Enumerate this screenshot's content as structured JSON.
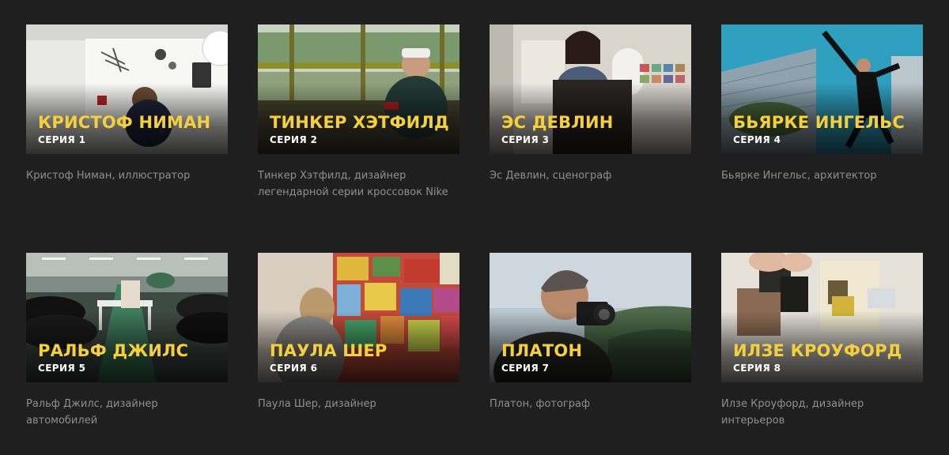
{
  "episodes": [
    {
      "title": "КРИСТОФ НИМАН",
      "episode": "СЕРИЯ 1",
      "description": "Кристоф Ниман, иллюстратор"
    },
    {
      "title": "ТИНКЕР ХЭТФИЛД",
      "episode": "СЕРИЯ 2",
      "description": "Тинкер Хэтфилд, дизайнер легендарной серии кроссовок Nike"
    },
    {
      "title": "ЭС ДЕВЛИН",
      "episode": "СЕРИЯ 3",
      "description": "Эс Девлин, сценограф"
    },
    {
      "title": "БЬЯРКЕ ИНГЕЛЬС",
      "episode": "СЕРИЯ 4",
      "description": "Бьярке Ингельс, архитектор"
    },
    {
      "title": "РАЛЬФ ДЖИЛС",
      "episode": "СЕРИЯ 5",
      "description": "Ральф Джилс, дизайнер автомобилей"
    },
    {
      "title": "ПАУЛА ШЕР",
      "episode": "СЕРИЯ 6",
      "description": "Паула Шер, дизайнер"
    },
    {
      "title": "ПЛАТОН",
      "episode": "СЕРИЯ 7",
      "description": "Платон, фотограф"
    },
    {
      "title": "ИЛЗЕ КРОУФОРД",
      "episode": "СЕРИЯ 8",
      "description": "Илзе Кроуфорд, дизайнер интерьеров"
    }
  ],
  "colors": {
    "background": "#1f1f1f",
    "title": "#f5cf3c",
    "episode": "#ffffff",
    "description": "#8f8f8f"
  }
}
